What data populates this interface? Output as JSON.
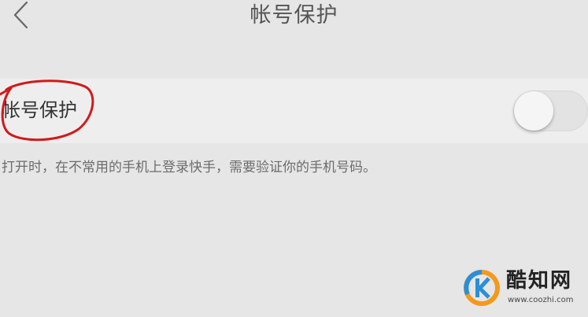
{
  "header": {
    "back_icon": "chevron-left-icon",
    "title": "帐号保护"
  },
  "setting": {
    "label": "帐号保护",
    "toggle_on": false,
    "annotation_color": "#d11a1a"
  },
  "description": "打开时，在不常用的手机上登录快手，需要验证你的手机号码。",
  "watermark": {
    "name": "酷知网",
    "url": "www.coozhi.com",
    "logo_colors": [
      "#f39a1e",
      "#2a8fd8"
    ]
  }
}
